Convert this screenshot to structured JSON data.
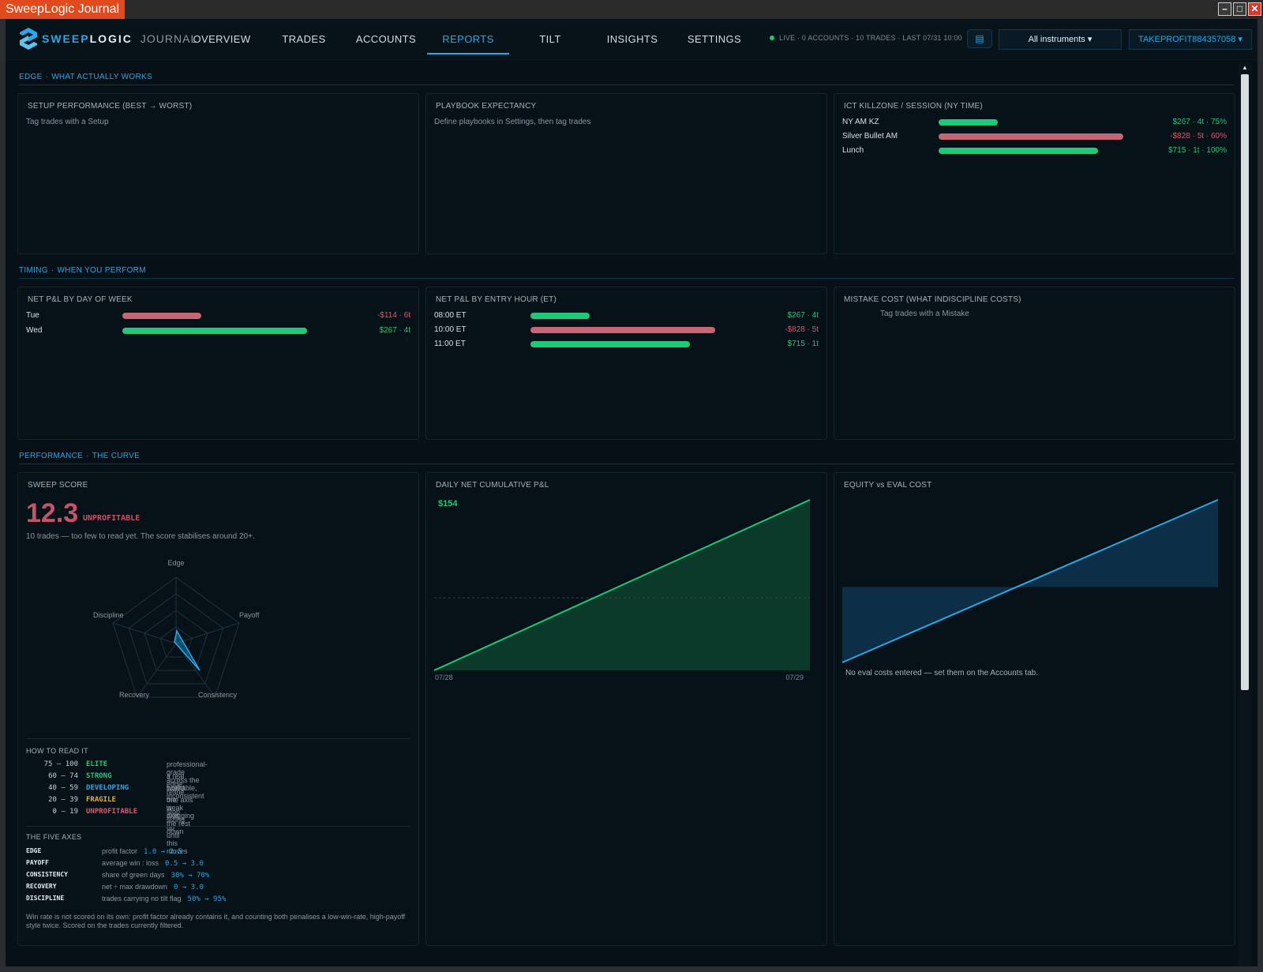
{
  "window": {
    "title": "SweepLogic Journal"
  },
  "nav": {
    "logo_brand_a": "SWEEP",
    "logo_brand_b": "LOGIC",
    "logo_sub": "JOURNAL",
    "tabs": [
      "OVERVIEW",
      "TRADES",
      "ACCOUNTS",
      "REPORTS",
      "TILT",
      "INSIGHTS",
      "SETTINGS"
    ],
    "active_tab": "REPORTS",
    "status": "LIVE · 0 ACCOUNTS · 10 TRADES · LAST 07/31 10:00",
    "instrument_select": "All instruments ▾",
    "account_select": "TAKEPROFIT884357058 ▾",
    "icon_button": "list-icon"
  },
  "sections": {
    "edge": {
      "a": "EDGE",
      "b": "WHAT ACTUALLY WORKS"
    },
    "timing": {
      "a": "TIMING",
      "b": "WHEN YOU PERFORM"
    },
    "performance": {
      "a": "PERFORMANCE",
      "b": "THE CURVE"
    }
  },
  "setup_performance": {
    "title": "SETUP PERFORMANCE (BEST → WORST)",
    "empty": "Tag trades with a Setup"
  },
  "playbook": {
    "title": "PLAYBOOK EXPECTANCY",
    "empty": "Define playbooks in Settings, then tag trades"
  },
  "killzone": {
    "title": "ICT KILLZONE / SESSION (NY TIME)",
    "rows": [
      {
        "label": "NY AM KZ",
        "value": "$267 · 4t · 75%",
        "pnl": 267,
        "sign": "pos"
      },
      {
        "label": "Silver Bullet AM",
        "value": "-$828 · 5t · 60%",
        "pnl": -828,
        "sign": "neg"
      },
      {
        "label": "Lunch",
        "value": "$715 · 1t · 100%",
        "pnl": 715,
        "sign": "pos"
      }
    ]
  },
  "day_of_week": {
    "title": "NET P&L BY DAY OF WEEK",
    "rows": [
      {
        "label": "Tue",
        "value": "-$114 · 6t",
        "pnl": -114,
        "sign": "neg"
      },
      {
        "label": "Wed",
        "value": "$267 · 4t",
        "pnl": 267,
        "sign": "pos"
      }
    ]
  },
  "entry_hour": {
    "title": "NET P&L BY ENTRY HOUR (ET)",
    "rows": [
      {
        "label": "08:00 ET",
        "value": "$267 · 4t",
        "pnl": 267,
        "sign": "pos"
      },
      {
        "label": "10:00 ET",
        "value": "-$828 · 5t",
        "pnl": -828,
        "sign": "neg"
      },
      {
        "label": "11:00 ET",
        "value": "$715 · 1t",
        "pnl": 715,
        "sign": "pos"
      }
    ]
  },
  "mistake_cost": {
    "title": "MISTAKE COST (WHAT INDISCIPLINE COSTS)",
    "empty": "Tag trades with a Mistake"
  },
  "sweep_score": {
    "title": "SWEEP SCORE",
    "score": "12.3",
    "tag": "UNPROFITABLE",
    "note": "10 trades — too few to read yet. The score stabilises around 20+.",
    "radar_labels": [
      "Edge",
      "Payoff",
      "Consistency",
      "Recovery",
      "Discipline"
    ],
    "how_title": "HOW TO READ IT",
    "levels": [
      {
        "range": "75 – 100",
        "name": "ELITE",
        "desc": "professional-grade across the board",
        "color": "#1fc97a"
      },
      {
        "range": "60 – 74",
        "name": "STRONG",
        "desc": "a real edge; refine the weak axis",
        "color": "#1fc97a"
      },
      {
        "range": "40 – 59",
        "name": "DEVELOPING",
        "desc": "workable, inconsistent",
        "color": "#2aa8e8"
      },
      {
        "range": "20 – 39",
        "name": "FRAGILE",
        "desc": "one axis is dragging the rest down",
        "color": "#e0b04a"
      },
      {
        "range": "0 – 19",
        "name": "UNPROFITABLE",
        "desc": "stop sizing up until this moves",
        "color": "#d85a6c"
      }
    ],
    "axes_title": "THE FIVE AXES",
    "axes": [
      {
        "name": "EDGE",
        "desc": "profit factor",
        "range": "1.0 → 2.5"
      },
      {
        "name": "PAYOFF",
        "desc": "average win : loss",
        "range": "0.5 → 3.0"
      },
      {
        "name": "CONSISTENCY",
        "desc": "share of green days",
        "range": "30% → 70%"
      },
      {
        "name": "RECOVERY",
        "desc": "net ÷ max drawdown",
        "range": "0 → 3.0"
      },
      {
        "name": "DISCIPLINE",
        "desc": "trades carrying no tilt flag",
        "range": "50% → 95%"
      }
    ],
    "footnote": "Win rate is not scored on its own: profit factor already contains it, and counting both penalises a low-win-rate, high-payoff style twice. Scored on the trades currently filtered."
  },
  "daily_cumulative": {
    "title": "DAILY NET CUMULATIVE P&L",
    "last_value": "$154",
    "x_start": "07/28",
    "x_end": "07/29"
  },
  "equity_eval": {
    "title": "EQUITY vs EVAL COST",
    "note": "No eval costs entered — set them on the Accounts tab."
  },
  "colors": {
    "accent": "#2aa8e8",
    "positive": "#1fc97a",
    "negative": "#d85a6c",
    "background": "#061016"
  },
  "chart_data": [
    {
      "type": "line",
      "title": "DAILY NET CUMULATIVE P&L",
      "x": [
        "07/28",
        "07/29"
      ],
      "series": [
        {
          "values": [
            -114,
            154
          ]
        }
      ]
    },
    {
      "type": "line",
      "title": "EQUITY vs EVAL COST",
      "series": [
        {
          "values": [
            -114,
            154
          ]
        }
      ]
    }
  ]
}
